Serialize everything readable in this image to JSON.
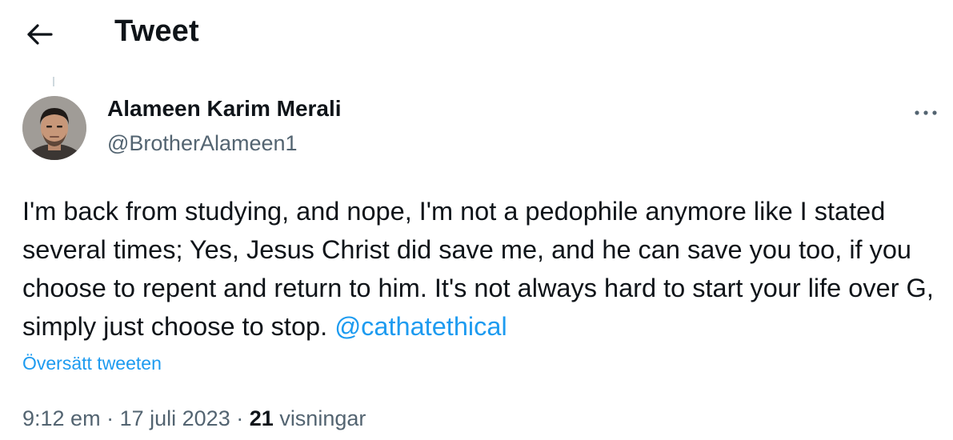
{
  "header": {
    "title": "Tweet",
    "back_icon": "arrow-left-icon"
  },
  "tweet": {
    "author": {
      "name": "Alameen Karim Merali",
      "handle": "@BrotherAlameen1",
      "avatar": "user-photo-avatar"
    },
    "more_icon": "more-horizontal-icon",
    "text": "I'm back from studying, and nope, I'm not a pedophile anymore like I stated several times; Yes, Jesus Christ did save me, and he can save you too, if you choose to repent and return to him. It's not always hard to start your life over G, simply just choose to stop.",
    "mention": "@cathatethical",
    "translate_label": "Översätt tweeten",
    "time": "9:12 em",
    "separator": "·",
    "date": "17 juli 2023",
    "views_count": "21",
    "views_label": "visningar"
  },
  "colors": {
    "accent": "#1d9bf0",
    "text_primary": "#0f1419",
    "text_secondary": "#536471"
  }
}
